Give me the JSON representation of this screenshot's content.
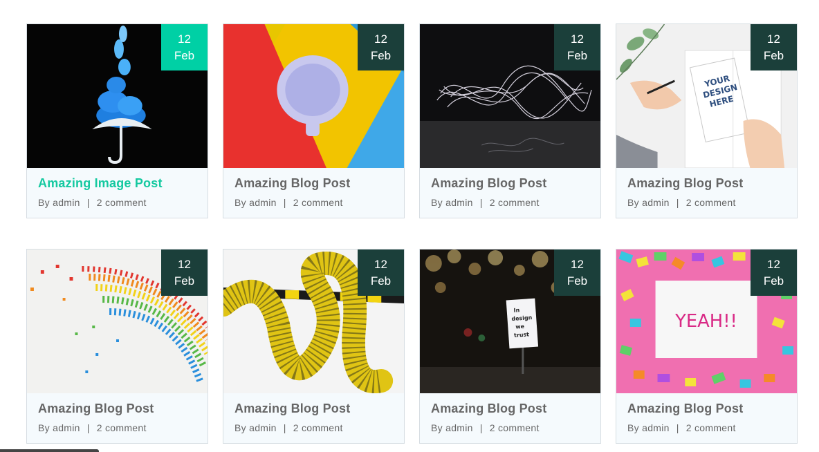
{
  "posts": [
    {
      "title": "Amazing Image Post",
      "day": "12",
      "month": "Feb",
      "author": "By admin",
      "separator": "|",
      "comments": "2 comment",
      "image": "umbrella-smoke"
    },
    {
      "title": "Amazing Blog Post",
      "day": "12",
      "month": "Feb",
      "author": "By admin",
      "separator": "|",
      "comments": "2 comment",
      "image": "cup-colors"
    },
    {
      "title": "Amazing Blog Post",
      "day": "12",
      "month": "Feb",
      "author": "By admin",
      "separator": "|",
      "comments": "2 comment",
      "image": "light-painting"
    },
    {
      "title": "Amazing Blog Post",
      "day": "12",
      "month": "Feb",
      "author": "By admin",
      "separator": "|",
      "comments": "2 comment",
      "image": "notebook-mockup"
    },
    {
      "title": "Amazing Blog Post",
      "day": "12",
      "month": "Feb",
      "author": "By admin",
      "separator": "|",
      "comments": "2 comment",
      "image": "paper-rainbow"
    },
    {
      "title": "Amazing Blog Post",
      "day": "12",
      "month": "Feb",
      "author": "By admin",
      "separator": "|",
      "comments": "2 comment",
      "image": "yellow-hose"
    },
    {
      "title": "Amazing Blog Post",
      "day": "12",
      "month": "Feb",
      "author": "By admin",
      "separator": "|",
      "comments": "2 comment",
      "image": "night-billboard"
    },
    {
      "title": "Amazing Blog Post",
      "day": "12",
      "month": "Feb",
      "author": "By admin",
      "separator": "|",
      "comments": "2 comment",
      "image": "confetti-yeah"
    }
  ],
  "image_text": {
    "notebook": [
      "YOUR",
      "DESIGN",
      "HERE"
    ],
    "billboard": [
      "In",
      "design",
      "we",
      "trust"
    ],
    "yeah": "YEAH!!"
  },
  "colors": {
    "accent": "#00d0a5",
    "date_bg": "#1b3f3a",
    "title": "#666666",
    "active_title": "#14c9a0",
    "card_bg": "#f5fafd"
  }
}
